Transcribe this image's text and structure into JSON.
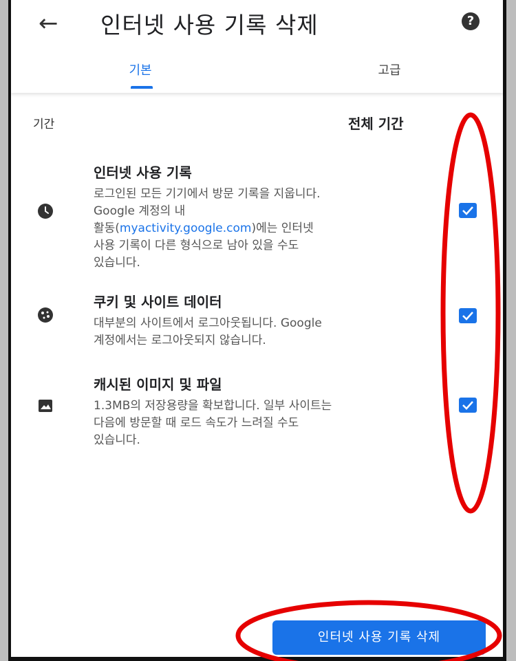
{
  "header": {
    "back_icon": "arrow-left-icon",
    "title": "인터넷 사용 기록 삭제",
    "help_icon": "help-circle-icon",
    "help_glyph": "?"
  },
  "tabs": [
    {
      "label": "기본",
      "active": true
    },
    {
      "label": "고급",
      "active": false
    }
  ],
  "period": {
    "label": "기간",
    "value": "전체 기간"
  },
  "items": [
    {
      "icon": "clock-icon",
      "title": "인터넷 사용 기록",
      "desc_line1": "로그인된 모든 기기에서 방문 기록을 지웁니다.",
      "desc_line2": "Google 계정의 내",
      "desc_prefix": "활동(",
      "desc_link": "myactivity.google.com",
      "desc_suffix": ")에는 인터넷",
      "desc_line4": "사용 기록이 다른 형식으로 남아 있을 수도",
      "desc_line5": "있습니다.",
      "checked": true
    },
    {
      "icon": "cookie-icon",
      "title": "쿠키 및 사이트 데이터",
      "desc_line1": "대부분의 사이트에서 로그아웃됩니다. Google",
      "desc_line2": "계정에서는 로그아웃되지 않습니다.",
      "checked": true
    },
    {
      "icon": "image-icon",
      "title": "캐시된 이미지 및 파일",
      "desc_line1": "1.3MB의 저장용량을 확보합니다. 일부 사이트는",
      "desc_line2": "다음에 방문할 때 로드 속도가 느려질 수도",
      "desc_line3": "있습니다.",
      "checked": true
    }
  ],
  "actions": {
    "delete_label": "인터넷 사용 기록 삭제"
  },
  "annotation_color": "#e60000",
  "accent_color": "#1a73e8"
}
